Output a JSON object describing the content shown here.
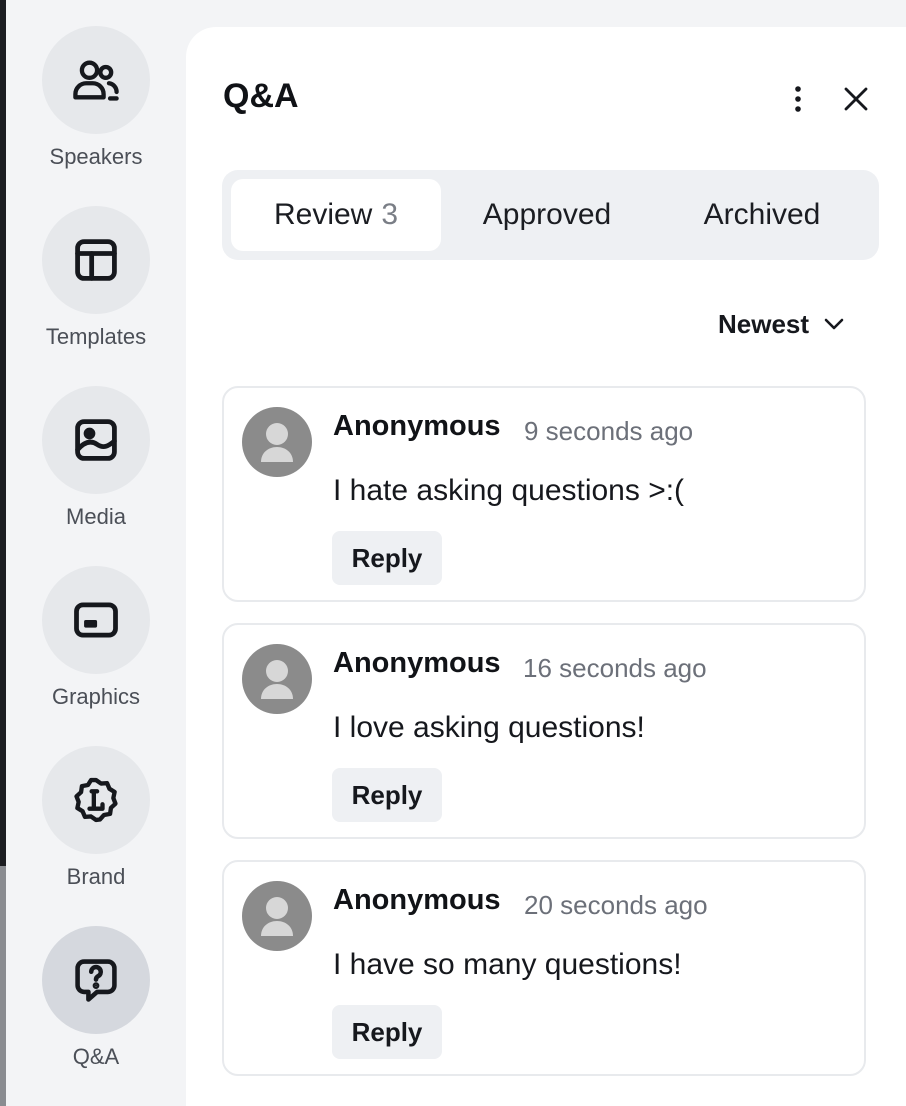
{
  "sidebar": {
    "items": [
      {
        "label": "Speakers",
        "icon": "speakers-icon"
      },
      {
        "label": "Templates",
        "icon": "templates-icon"
      },
      {
        "label": "Media",
        "icon": "media-icon"
      },
      {
        "label": "Graphics",
        "icon": "graphics-icon"
      },
      {
        "label": "Brand",
        "icon": "brand-icon"
      },
      {
        "label": "Q&A",
        "icon": "qa-icon",
        "active": true
      }
    ]
  },
  "panel": {
    "title": "Q&A",
    "more_icon": "more-vertical-icon",
    "close_icon": "close-icon"
  },
  "tabs": [
    {
      "label": "Review",
      "count": "3",
      "active": true
    },
    {
      "label": "Approved"
    },
    {
      "label": "Archived"
    }
  ],
  "sort": {
    "label": "Newest",
    "icon": "chevron-down-icon"
  },
  "questions": [
    {
      "author": "Anonymous",
      "time": "9 seconds ago",
      "text": "I hate asking questions >:(",
      "reply_label": "Reply"
    },
    {
      "author": "Anonymous",
      "time": "16 seconds ago",
      "text": "I love asking questions!",
      "reply_label": "Reply"
    },
    {
      "author": "Anonymous",
      "time": "20 seconds ago",
      "text": "I have so many questions!",
      "reply_label": "Reply"
    }
  ],
  "colors": {
    "background": "#f3f4f6",
    "panel": "#ffffff",
    "tab_track": "#eef0f3",
    "avatar": "#8b8b8b",
    "muted_text": "#6c7079"
  }
}
